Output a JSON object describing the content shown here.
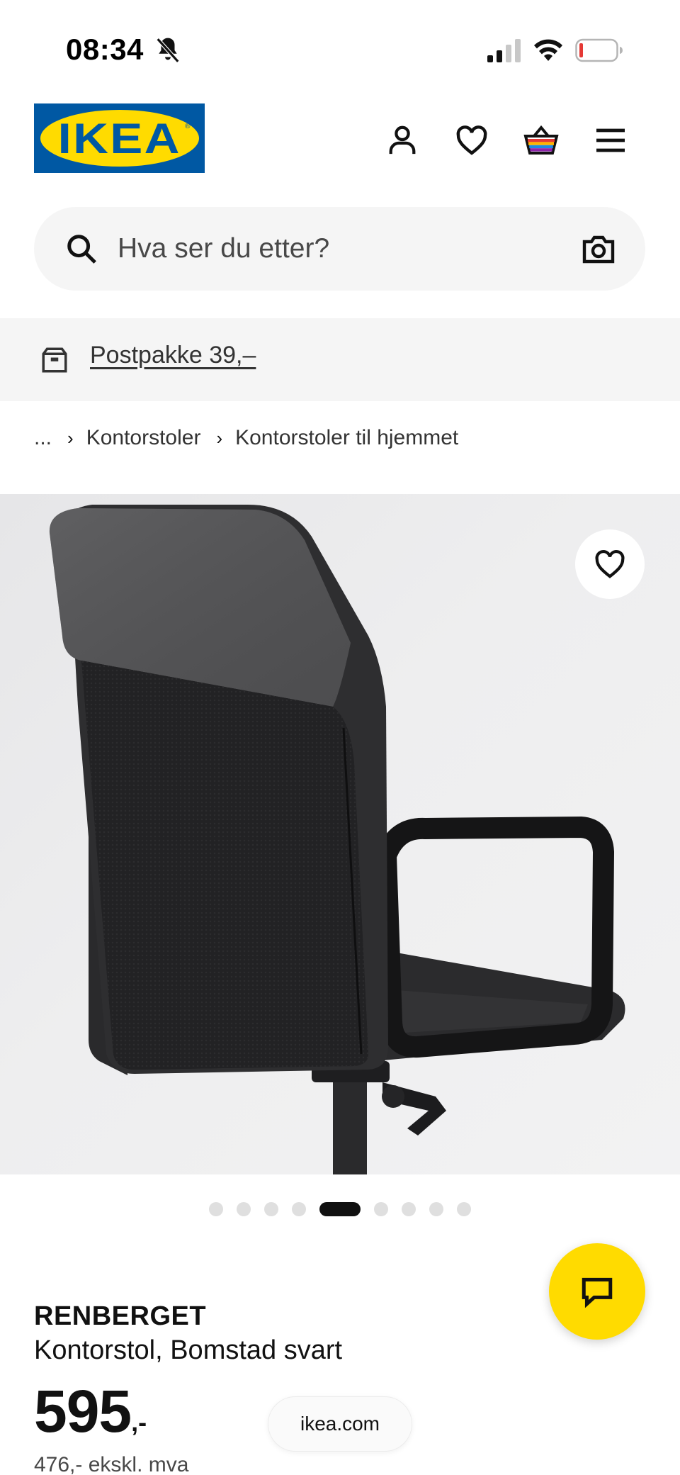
{
  "status_bar": {
    "time": "08:34",
    "icons": [
      "bell-slash-icon",
      "cellular-signal-icon",
      "wifi-icon",
      "battery-low-icon"
    ]
  },
  "header": {
    "logo_text": "IKEA",
    "icons": [
      "user-icon",
      "heart-icon",
      "basket-icon",
      "hamburger-menu-icon"
    ],
    "brand_colors": {
      "blue": "#0058a3",
      "yellow": "#ffdb00"
    }
  },
  "search": {
    "placeholder": "Hva ser du etter?",
    "icons": [
      "search-icon",
      "camera-icon"
    ]
  },
  "shipping_banner": {
    "link_text": "Postpakke 39,–",
    "icon": "parcel-box-icon"
  },
  "breadcrumb": {
    "items": [
      "...",
      "Kontorstoler",
      "Kontorstoler til hjemmet"
    ]
  },
  "gallery": {
    "image_count": 9,
    "active_index": 5
  },
  "product": {
    "name": "RENBERGET",
    "description": "Kontorstol, Bomstad svart",
    "price": "595",
    "price_suffix": ",-",
    "price_ex_vat": "476,- ekskl. mva"
  },
  "browser": {
    "url_text": "ikea.com"
  },
  "chat": {
    "icon": "chat-bubble-icon",
    "color": "#ffdb00"
  }
}
